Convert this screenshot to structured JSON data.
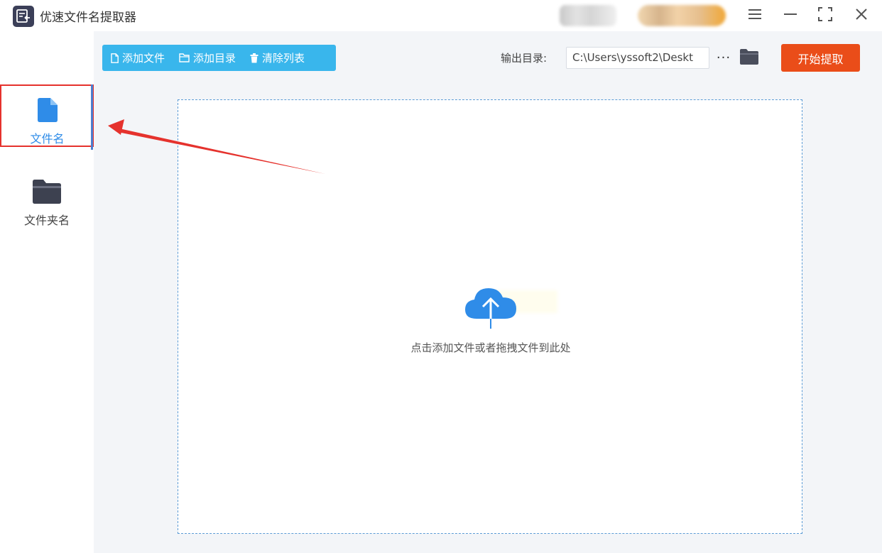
{
  "app": {
    "title": "优速文件名提取器"
  },
  "window_controls": [
    "menu-icon",
    "minimize-icon",
    "maximize-icon",
    "close-icon"
  ],
  "sidebar": {
    "items": [
      {
        "label": "文件名",
        "icon": "file-icon",
        "active": true
      },
      {
        "label": "文件夹名",
        "icon": "folder-icon",
        "active": false
      }
    ]
  },
  "toolbar": {
    "add_file": "添加文件",
    "add_dir": "添加目录",
    "clear_list": "清除列表",
    "output_label": "输出目录:",
    "output_path": "C:\\Users\\yssoft2\\Deskt",
    "more": "···",
    "start": "开始提取"
  },
  "dropzone": {
    "icon": "cloud-upload-icon",
    "text": "点击添加文件或者拖拽文件到此处"
  },
  "colors": {
    "accent_blue": "#39b6ec",
    "start_orange": "#ea4d19",
    "annotation_red": "#e5322d",
    "icon_blue": "#2f8ce8"
  }
}
